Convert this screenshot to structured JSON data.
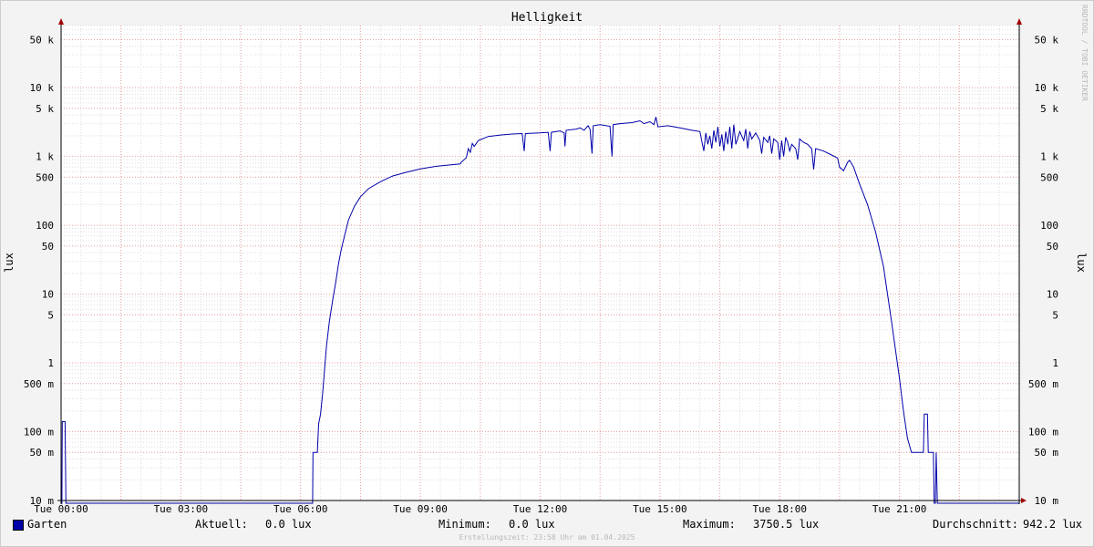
{
  "chart_data": {
    "type": "line",
    "title": "Helligkeit",
    "ylabel": "lux",
    "watermark": "RRDTOOL / TOBI OETIKER",
    "scale": "log",
    "ylim": [
      0.01,
      80000
    ],
    "xlim": [
      0,
      24
    ],
    "grid": true,
    "x_ticks": [
      {
        "value": 0,
        "label": "Tue 00:00"
      },
      {
        "value": 3,
        "label": "Tue 03:00"
      },
      {
        "value": 6,
        "label": "Tue 06:00"
      },
      {
        "value": 9,
        "label": "Tue 09:00"
      },
      {
        "value": 12,
        "label": "Tue 12:00"
      },
      {
        "value": 15,
        "label": "Tue 15:00"
      },
      {
        "value": 18,
        "label": "Tue 18:00"
      },
      {
        "value": 21,
        "label": "Tue 21:00"
      }
    ],
    "y_ticks": [
      {
        "value": 0.01,
        "label": "10 m"
      },
      {
        "value": 0.05,
        "label": "50 m"
      },
      {
        "value": 0.1,
        "label": "100 m"
      },
      {
        "value": 0.5,
        "label": "500 m"
      },
      {
        "value": 1,
        "label": "1"
      },
      {
        "value": 5,
        "label": "5"
      },
      {
        "value": 10,
        "label": "10"
      },
      {
        "value": 50,
        "label": "50"
      },
      {
        "value": 100,
        "label": "100"
      },
      {
        "value": 500,
        "label": "500"
      },
      {
        "value": 1000,
        "label": "1 k"
      },
      {
        "value": 5000,
        "label": "5 k"
      },
      {
        "value": 10000,
        "label": "10 k"
      },
      {
        "value": 50000,
        "label": "50 k"
      }
    ],
    "series": [
      {
        "name": "Garten",
        "color": "#0000aa",
        "points": [
          [
            0.0,
            0.001
          ],
          [
            0.02,
            0.001
          ],
          [
            0.03,
            0.14
          ],
          [
            0.1,
            0.14
          ],
          [
            0.12,
            0.001
          ],
          [
            6.3,
            0.001
          ],
          [
            6.31,
            0.05
          ],
          [
            6.42,
            0.05
          ],
          [
            6.45,
            0.13
          ],
          [
            6.5,
            0.18
          ],
          [
            6.55,
            0.35
          ],
          [
            6.6,
            0.8
          ],
          [
            6.65,
            1.8
          ],
          [
            6.72,
            4
          ],
          [
            6.8,
            8
          ],
          [
            6.88,
            15
          ],
          [
            6.95,
            28
          ],
          [
            7.02,
            45
          ],
          [
            7.1,
            70
          ],
          [
            7.2,
            120
          ],
          [
            7.35,
            190
          ],
          [
            7.5,
            260
          ],
          [
            7.7,
            340
          ],
          [
            8.0,
            430
          ],
          [
            8.3,
            520
          ],
          [
            8.6,
            580
          ],
          [
            9.0,
            660
          ],
          [
            9.4,
            720
          ],
          [
            9.8,
            760
          ],
          [
            10.0,
            780
          ],
          [
            10.02,
            820
          ],
          [
            10.15,
            960
          ],
          [
            10.2,
            1300
          ],
          [
            10.25,
            1150
          ],
          [
            10.3,
            1550
          ],
          [
            10.35,
            1400
          ],
          [
            10.45,
            1700
          ],
          [
            10.7,
            1950
          ],
          [
            11.0,
            2050
          ],
          [
            11.3,
            2120
          ],
          [
            11.55,
            2150
          ],
          [
            11.6,
            1200
          ],
          [
            11.63,
            2150
          ],
          [
            12.0,
            2200
          ],
          [
            12.2,
            2250
          ],
          [
            12.25,
            1200
          ],
          [
            12.28,
            2250
          ],
          [
            12.5,
            2350
          ],
          [
            12.6,
            2200
          ],
          [
            12.62,
            1400
          ],
          [
            12.65,
            2400
          ],
          [
            12.9,
            2500
          ],
          [
            13.0,
            2600
          ],
          [
            13.1,
            2400
          ],
          [
            13.2,
            2800
          ],
          [
            13.25,
            2500
          ],
          [
            13.3,
            1100
          ],
          [
            13.33,
            2800
          ],
          [
            13.5,
            2900
          ],
          [
            13.75,
            2750
          ],
          [
            13.8,
            1000
          ],
          [
            13.83,
            2900
          ],
          [
            14.0,
            3000
          ],
          [
            14.3,
            3100
          ],
          [
            14.5,
            3300
          ],
          [
            14.6,
            3000
          ],
          [
            14.75,
            3200
          ],
          [
            14.85,
            2900
          ],
          [
            14.9,
            3750
          ],
          [
            14.95,
            2700
          ],
          [
            15.2,
            2800
          ],
          [
            15.5,
            2600
          ],
          [
            15.8,
            2400
          ],
          [
            16.0,
            2300
          ],
          [
            16.1,
            1200
          ],
          [
            16.15,
            2200
          ],
          [
            16.2,
            1500
          ],
          [
            16.25,
            2000
          ],
          [
            16.3,
            1300
          ],
          [
            16.35,
            2400
          ],
          [
            16.4,
            1600
          ],
          [
            16.45,
            2700
          ],
          [
            16.5,
            1400
          ],
          [
            16.55,
            2100
          ],
          [
            16.6,
            1200
          ],
          [
            16.65,
            2300
          ],
          [
            16.7,
            1500
          ],
          [
            16.75,
            2700
          ],
          [
            16.8,
            1300
          ],
          [
            16.85,
            2900
          ],
          [
            16.9,
            1500
          ],
          [
            17.0,
            2300
          ],
          [
            17.1,
            1700
          ],
          [
            17.15,
            2500
          ],
          [
            17.2,
            1300
          ],
          [
            17.25,
            2300
          ],
          [
            17.3,
            1800
          ],
          [
            17.4,
            2200
          ],
          [
            17.5,
            1700
          ],
          [
            17.55,
            1100
          ],
          [
            17.6,
            1900
          ],
          [
            17.7,
            1600
          ],
          [
            17.75,
            2000
          ],
          [
            17.8,
            1100
          ],
          [
            17.85,
            1800
          ],
          [
            17.95,
            1600
          ],
          [
            18.0,
            900
          ],
          [
            18.05,
            1700
          ],
          [
            18.1,
            1000
          ],
          [
            18.15,
            1900
          ],
          [
            18.2,
            1600
          ],
          [
            18.25,
            1200
          ],
          [
            18.3,
            1500
          ],
          [
            18.4,
            1300
          ],
          [
            18.45,
            900
          ],
          [
            18.5,
            1800
          ],
          [
            18.6,
            1600
          ],
          [
            18.7,
            1500
          ],
          [
            18.8,
            1300
          ],
          [
            18.85,
            650
          ],
          [
            18.9,
            1300
          ],
          [
            19.1,
            1200
          ],
          [
            19.3,
            1050
          ],
          [
            19.45,
            950
          ],
          [
            19.5,
            700
          ],
          [
            19.6,
            620
          ],
          [
            19.7,
            820
          ],
          [
            19.75,
            880
          ],
          [
            19.85,
            700
          ],
          [
            20.0,
            400
          ],
          [
            20.2,
            200
          ],
          [
            20.4,
            80
          ],
          [
            20.6,
            25
          ],
          [
            20.8,
            4
          ],
          [
            21.0,
            0.6
          ],
          [
            21.1,
            0.2
          ],
          [
            21.2,
            0.08
          ],
          [
            21.3,
            0.05
          ],
          [
            21.6,
            0.05
          ],
          [
            21.62,
            0.18
          ],
          [
            21.7,
            0.18
          ],
          [
            21.72,
            0.05
          ],
          [
            21.85,
            0.05
          ],
          [
            21.87,
            0.001
          ],
          [
            21.9,
            0.001
          ],
          [
            21.92,
            0.05
          ],
          [
            21.95,
            0.001
          ],
          [
            24.0,
            0.001
          ]
        ]
      }
    ]
  },
  "legend": {
    "series_name": "Garten",
    "current_label": "Aktuell:",
    "current_value": "0.0 lux",
    "min_label": "Minimum:",
    "min_value": "0.0 lux",
    "max_label": "Maximum:",
    "max_value": "3750.5 lux",
    "avg_label": "Durchschnitt:",
    "avg_value": "942.2 lux"
  },
  "footer": "Erstellungszeit: 23:58 Uhr am 01.04.2025"
}
